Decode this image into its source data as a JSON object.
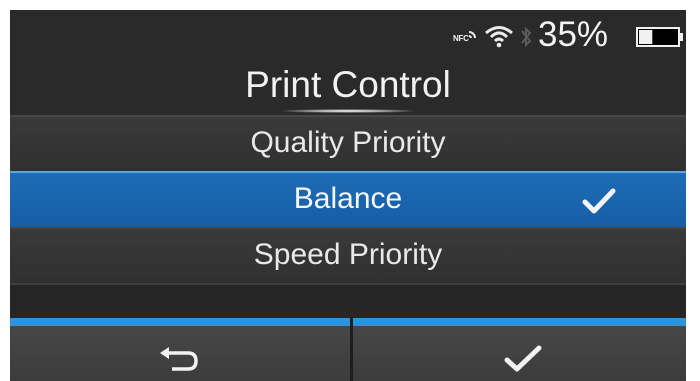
{
  "status_bar": {
    "nfc_label": "NFC",
    "battery_percent": "35%",
    "battery_level": 0.35,
    "icons": [
      "nfc-icon",
      "wifi-icon",
      "bluetooth-icon",
      "battery-icon"
    ]
  },
  "screen": {
    "title": "Print Control"
  },
  "options": [
    {
      "label": "Quality Priority",
      "selected": false
    },
    {
      "label": "Balance",
      "selected": true
    },
    {
      "label": "Speed Priority",
      "selected": false
    }
  ],
  "softkeys": {
    "left_icon": "back-arrow-icon",
    "right_icon": "confirm-check-icon"
  },
  "colors": {
    "background": "#2a2a2a",
    "selected_row": "#1d6cb6",
    "softkey_accent": "#2f93d8"
  }
}
